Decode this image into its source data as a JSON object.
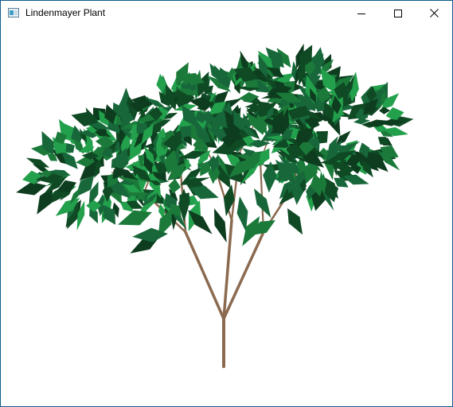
{
  "window": {
    "title": "Lindenmayer Plant",
    "app_icon": "window-app-icon",
    "controls": {
      "minimize_icon": "minimize-icon",
      "maximize_icon": "maximize-icon",
      "close_icon": "close-icon"
    }
  },
  "colors": {
    "window_border": "#0f5c8a",
    "background": "#ffffff",
    "branch": "#8b6a4f",
    "leaf_dark": "#0f4a24",
    "leaf_mid": "#1b7a3a",
    "leaf_light": "#23a04c"
  }
}
